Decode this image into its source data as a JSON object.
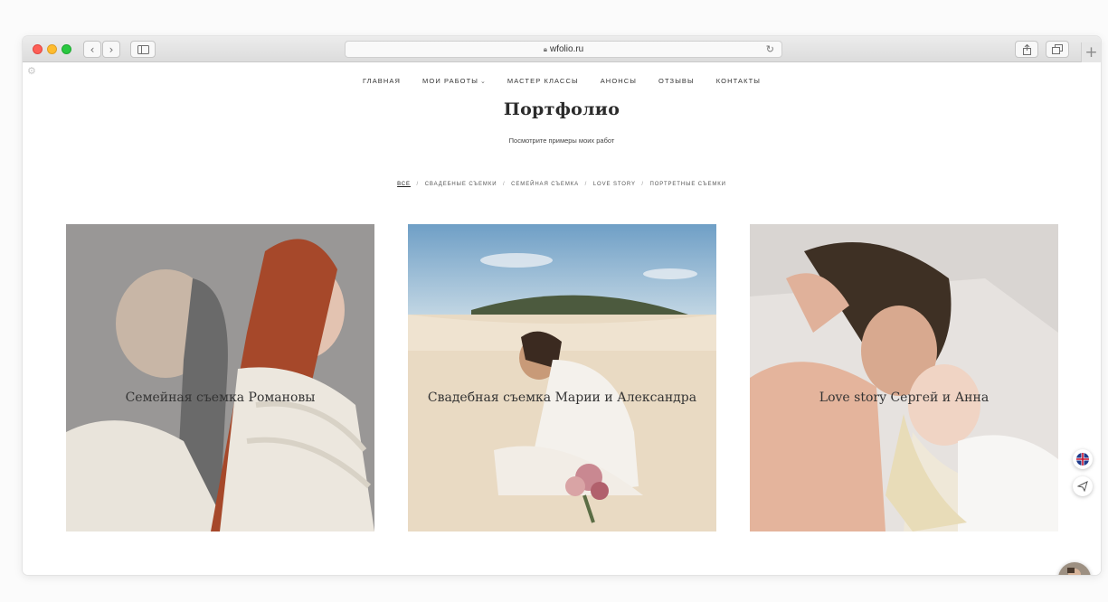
{
  "browser": {
    "url": "wfolio.ru",
    "lock_icon": "lock-icon",
    "reload_icon": "reload-icon",
    "back_icon": "chevron-left-icon",
    "forward_icon": "chevron-right-icon",
    "sidebar_icon": "sidebar-icon",
    "share_icon": "share-icon",
    "tabs_icon": "tabs-icon",
    "new_tab_label": "+"
  },
  "nav": {
    "items": [
      "ГЛАВНАЯ",
      "МОИ РАБОТЫ",
      "МАСТЕР КЛАССЫ",
      "АНОНСЫ",
      "ОТЗЫВЫ",
      "КОНТАКТЫ"
    ],
    "dropdown_icon": "chevron-down-icon"
  },
  "page": {
    "title": "Портфолио",
    "subtitle": "Посмотрите примеры моих работ"
  },
  "filters": {
    "items": [
      "ВСЕ",
      "СВАДЕБНЫЕ СЪЕМКИ",
      "СЕМЕЙНАЯ СЪЕМКА",
      "LOVE STORY",
      "ПОРТРЕТНЫЕ СЪЕМКИ"
    ],
    "separator": "/",
    "active": "ВСЕ"
  },
  "cards": [
    {
      "caption": "Семейная съемка Романовы"
    },
    {
      "caption": "Свадебная съемка Марии и Александра"
    },
    {
      "caption": "Love story Сергей и Анна"
    }
  ],
  "widgets": {
    "language_icon": "uk-flag-icon",
    "telegram_icon": "send-icon",
    "chat_avatar": "avatar"
  },
  "colors": {
    "text": "#2b2b2b",
    "red_light": "#fd5f57",
    "yellow_light": "#febc2e",
    "green_light": "#29c840"
  }
}
